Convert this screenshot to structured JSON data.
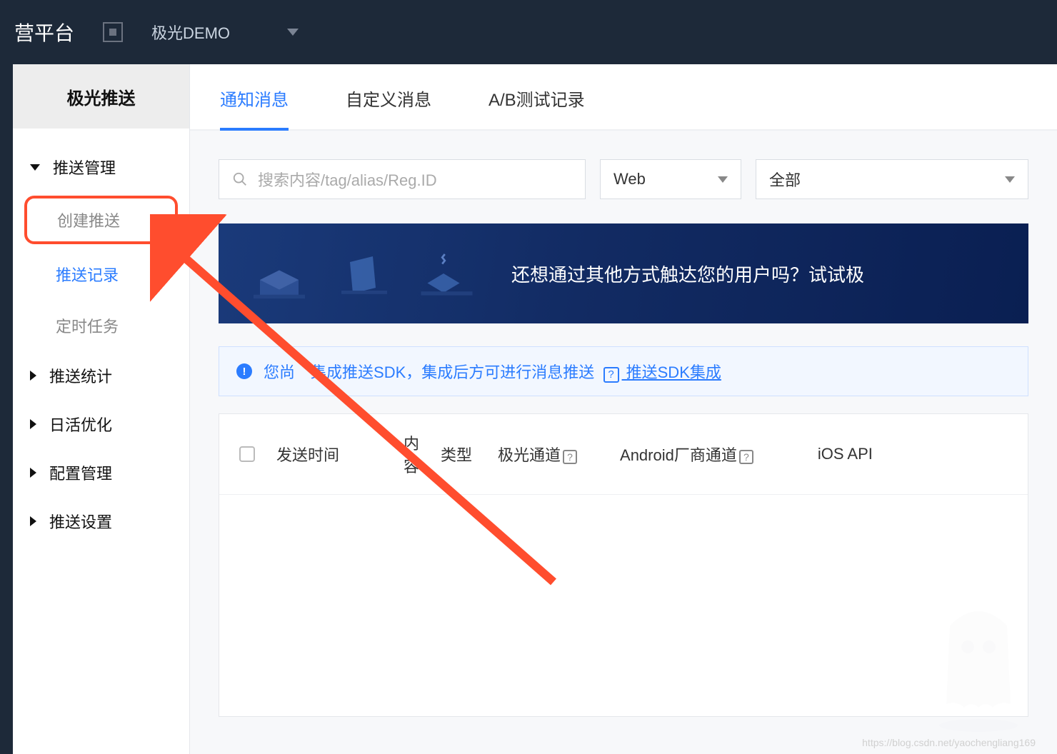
{
  "header": {
    "title": "营平台",
    "app_name": "极光DEMO"
  },
  "sidebar": {
    "title": "极光推送",
    "groups": [
      {
        "label": "推送管理",
        "expanded": true,
        "children": [
          {
            "label": "创建推送",
            "highlighted": true
          },
          {
            "label": "推送记录",
            "active": true
          },
          {
            "label": "定时任务"
          }
        ]
      },
      {
        "label": "推送统计"
      },
      {
        "label": "日活优化"
      },
      {
        "label": "配置管理"
      },
      {
        "label": "推送设置"
      }
    ]
  },
  "tabs": [
    {
      "label": "通知消息",
      "active": true
    },
    {
      "label": "自定义消息"
    },
    {
      "label": "A/B测试记录"
    }
  ],
  "filters": {
    "search_placeholder": "搜索内容/tag/alias/Reg.ID",
    "platform": {
      "value": "Web"
    },
    "status": {
      "value": "全部"
    }
  },
  "banner": {
    "text": "还想通过其他方式触达您的用户吗？试试极"
  },
  "alert": {
    "text_prefix": "您尚",
    "text_mid": "集成推送SDK，集成后方可进行消息推送",
    "link_label": " 推送SDK集成"
  },
  "table": {
    "columns": {
      "send_time": "发送时间",
      "content": "内容",
      "type": "类型",
      "jg_channel": "极光通道",
      "android_channel": "Android厂商通道",
      "ios": "iOS API"
    }
  },
  "watermark": "https://blog.csdn.net/yaochengliang169"
}
